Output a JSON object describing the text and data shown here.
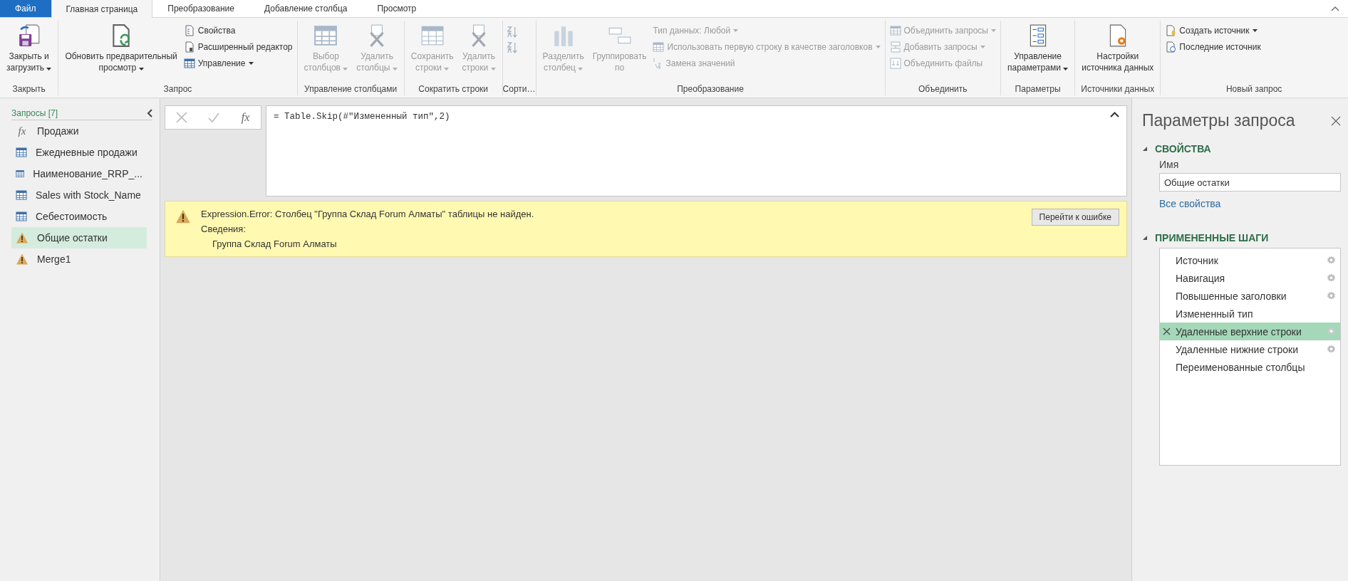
{
  "ribbon": {
    "tabs": [
      {
        "label": "Файл",
        "kind": "file",
        "selected": false
      },
      {
        "label": "Главная страница",
        "kind": "tab",
        "selected": true
      },
      {
        "label": "Преобразование",
        "kind": "tab",
        "selected": false
      },
      {
        "label": "Добавление столбца",
        "kind": "tab",
        "selected": false
      },
      {
        "label": "Просмотр",
        "kind": "tab",
        "selected": false
      }
    ],
    "groups": [
      {
        "label": "Закрыть",
        "items": [
          {
            "kind": "large",
            "label": "Закрыть и\nзагрузить",
            "dropdown": true,
            "disabled": false
          }
        ]
      },
      {
        "label": "Запрос",
        "items": [
          {
            "kind": "large",
            "label": "Обновить предварительный\nпросмотр",
            "dropdown": true,
            "disabled": false
          },
          {
            "kind": "small",
            "label": "Свойства",
            "dropdown": false,
            "disabled": false
          },
          {
            "kind": "small",
            "label": "Расширенный редактор",
            "dropdown": false,
            "disabled": false
          },
          {
            "kind": "small",
            "label": "Управление",
            "dropdown": true,
            "disabled": false
          }
        ]
      },
      {
        "label": "Управление столбцами",
        "items": [
          {
            "kind": "large",
            "label": "Выбор\nстолбцов",
            "dropdown": true,
            "disabled": true
          },
          {
            "kind": "large",
            "label": "Удалить\nстолбцы",
            "dropdown": true,
            "disabled": true
          }
        ]
      },
      {
        "label": "Сократить строки",
        "items": [
          {
            "kind": "large",
            "label": "Сохранить\nстроки",
            "dropdown": true,
            "disabled": true
          },
          {
            "kind": "large",
            "label": "Удалить\nстроки",
            "dropdown": true,
            "disabled": true
          }
        ]
      },
      {
        "label": "Сорти…",
        "items": [
          {
            "kind": "icon",
            "disabled": true
          },
          {
            "kind": "icon",
            "disabled": true
          }
        ]
      },
      {
        "label": "Преобразование",
        "items": [
          {
            "kind": "large",
            "label": "Разделить\nстолбец",
            "dropdown": true,
            "disabled": true
          },
          {
            "kind": "large",
            "label": "Группировать\nпо",
            "dropdown": false,
            "disabled": true
          },
          {
            "kind": "small",
            "label": "Тип данных: Любой",
            "dropdown": true,
            "disabled": true
          },
          {
            "kind": "small",
            "label": "Использовать первую строку в качестве заголовков",
            "dropdown": true,
            "disabled": true
          },
          {
            "kind": "small",
            "label": "Замена значений",
            "dropdown": false,
            "disabled": true
          }
        ]
      },
      {
        "label": "Объединить",
        "items": [
          {
            "kind": "small",
            "label": "Объединить запросы",
            "dropdown": true,
            "disabled": true
          },
          {
            "kind": "small",
            "label": "Добавить запросы",
            "dropdown": true,
            "disabled": true
          },
          {
            "kind": "small",
            "label": "Объединить файлы",
            "dropdown": false,
            "disabled": true
          }
        ]
      },
      {
        "label": "Параметры",
        "items": [
          {
            "kind": "large",
            "label": "Управление\nпараметрами",
            "dropdown": true,
            "disabled": false
          }
        ]
      },
      {
        "label": "Источники данных",
        "items": [
          {
            "kind": "large",
            "label": "Настройки\nисточника данных",
            "dropdown": false,
            "disabled": false
          }
        ]
      },
      {
        "label": "Новый запрос",
        "items": [
          {
            "kind": "small",
            "label": "Создать источник",
            "dropdown": true,
            "disabled": false
          },
          {
            "kind": "small",
            "label": "Последние источник",
            "dropdown": false,
            "disabled": false
          }
        ]
      }
    ]
  },
  "queries": {
    "title": "Запросы [7]",
    "items": [
      {
        "kind": "function",
        "glyph": "fx",
        "label": "Продажи",
        "selected": false
      },
      {
        "kind": "table",
        "label": "Ежедневные продажи",
        "selected": false
      },
      {
        "kind": "table",
        "label": "Наименование_RRP_...",
        "selected": false
      },
      {
        "kind": "table",
        "label": "Sales with Stock_Name",
        "selected": false
      },
      {
        "kind": "table",
        "label": "Себестоимость",
        "selected": false
      },
      {
        "kind": "warning",
        "label": "Общие остатки",
        "selected": true
      },
      {
        "kind": "warning",
        "label": "Merge1",
        "selected": false
      }
    ]
  },
  "formula_bar": {
    "fx_glyph": "fx",
    "formula": "= Table.Skip(#\"Измененный тип\",2)"
  },
  "error": {
    "message": "Expression.Error: Столбец \"Группа Склад Forum Алматы\" таблицы не найден.",
    "details_label": "Сведения:",
    "detail": "Группа Склад Forum Алматы",
    "button": "Перейти к ошибке"
  },
  "query_settings": {
    "title": "Параметры запроса",
    "properties": {
      "heading": "СВОЙСТВА",
      "expanded": true,
      "name_label": "Имя",
      "name_value": "Общие остатки",
      "link": "Все свойства"
    },
    "steps_section": {
      "heading": "ПРИМЕНЕННЫЕ ШАГИ",
      "expanded": true
    },
    "steps": [
      {
        "label": "Источник",
        "selected": false,
        "settings": true,
        "error": false
      },
      {
        "label": "Навигация",
        "selected": false,
        "settings": true,
        "error": false
      },
      {
        "label": "Повышенные заголовки",
        "selected": false,
        "settings": true,
        "error": false
      },
      {
        "label": "Измененный тип",
        "selected": false,
        "settings": false,
        "error": false
      },
      {
        "label": "Удаленные верхние строки",
        "selected": true,
        "settings": true,
        "error": true
      },
      {
        "label": "Удаленные нижние строки",
        "selected": false,
        "settings": true,
        "error": false
      },
      {
        "label": "Переименованные столбцы",
        "selected": false,
        "settings": false,
        "error": false
      }
    ]
  }
}
